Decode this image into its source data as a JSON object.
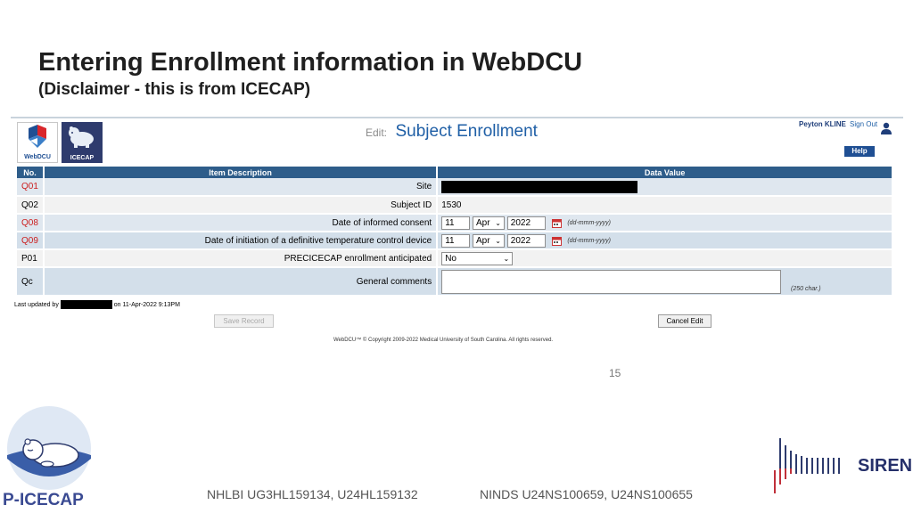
{
  "slide": {
    "title": "Entering Enrollment information in WebDCU",
    "subtitle": "(Disclaimer - this is from ICECAP)",
    "page_number": "15"
  },
  "app": {
    "logo_webdcu": "WebDCU",
    "logo_icecap": "ICECAP",
    "edit_label": "Edit:",
    "form_title": "Subject Enrollment",
    "user_name": "Peyton KLINE",
    "sign_out": "Sign Out",
    "help": "Help"
  },
  "table": {
    "headers": {
      "no": "No.",
      "item": "Item Description",
      "value": "Data Value"
    },
    "rows": [
      {
        "no": "Q01",
        "item": "Site"
      },
      {
        "no": "Q02",
        "item": "Subject ID",
        "value": "1530"
      },
      {
        "no": "Q08",
        "item": "Date of informed consent",
        "day": "11",
        "month": "Apr",
        "year": "2022",
        "hint": "(dd-mmm-yyyy)"
      },
      {
        "no": "Q09",
        "item": "Date of initiation of a definitive temperature control device",
        "day": "11",
        "month": "Apr",
        "year": "2022",
        "hint": "(dd-mmm-yyyy)"
      },
      {
        "no": "P01",
        "item": "PRECICECAP enrollment anticipated",
        "value": "No"
      },
      {
        "no": "Qc",
        "item": "General comments",
        "hint": "(250 char.)"
      }
    ]
  },
  "footer": {
    "last_updated_prefix": "Last updated by",
    "last_updated_suffix": "on 11-Apr-2022  9:13PM",
    "save_button": "Save Record",
    "cancel_button": "Cancel Edit",
    "copyright": "WebDCU™  © Copyright 2009-2022 Medical University of South Carolina. All rights reserved."
  },
  "branding": {
    "picecap": "P-ICECAP",
    "grant_nhlbi": "NHLBI UG3HL159134, U24HL159132",
    "grant_ninds": "NINDS U24NS100659, U24NS100655",
    "siren": "SIREN"
  },
  "colors": {
    "header_bar": "#2e5d8a",
    "required_red": "#cc1e1e",
    "title_blue": "#1f5fa6",
    "picecap_navy": "#3a4a92"
  }
}
